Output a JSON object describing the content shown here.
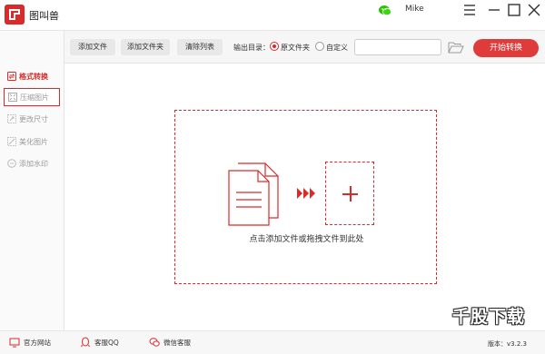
{
  "app": {
    "title": "图叫兽",
    "user": "Mike"
  },
  "sidebar": {
    "items": [
      {
        "label": "格式转换",
        "icon": "convert-icon",
        "state": "active"
      },
      {
        "label": "压缩图片",
        "icon": "compress-icon",
        "state": "selected"
      },
      {
        "label": "更改尺寸",
        "icon": "resize-icon",
        "state": "normal"
      },
      {
        "label": "美化图片",
        "icon": "beautify-icon",
        "state": "normal"
      },
      {
        "label": "添加水印",
        "icon": "watermark-icon",
        "state": "normal"
      }
    ]
  },
  "toolbar": {
    "add_file": "添加文件",
    "add_folder": "添加文件夹",
    "clear_list": "清除列表",
    "output_label": "输出目录：",
    "option_source": "原文件夹",
    "option_custom": "自定义",
    "selected_option": "原文件夹",
    "path_value": "",
    "start": "开始转换"
  },
  "dropzone": {
    "hint": "点击添加文件或拖拽文件到此处"
  },
  "statusbar": {
    "website": "官方网站",
    "qq": "客服QQ",
    "wechat": "微信客服",
    "version": "版本：v3.2.3"
  },
  "watermark": "千股下载",
  "colors": {
    "accent": "#d92b2b",
    "start_button": "#e03b3b",
    "wechat": "#2dc100"
  }
}
